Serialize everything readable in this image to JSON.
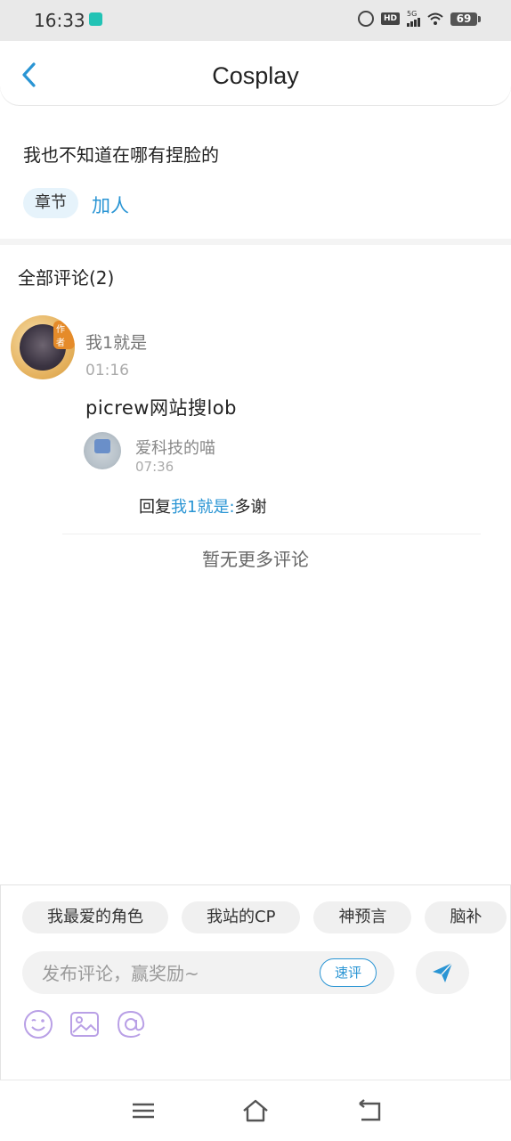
{
  "status": {
    "time": "16:33",
    "battery": "69",
    "network": "5G",
    "hd_label": "HD"
  },
  "header": {
    "title": "Cosplay",
    "back_icon": "chevron-left-icon"
  },
  "post": {
    "text": "我也不知道在哪有捏脸的",
    "tag_label": "章节",
    "tag_link": "加人"
  },
  "comments": {
    "title": "全部评论(2)",
    "items": [
      {
        "user": "我1就是",
        "time": "01:16",
        "text": "picrew网站搜lob",
        "avatar_badge": "作者",
        "reply": {
          "user": "爱科技的喵",
          "time": "07:36",
          "prefix": "回复",
          "mention": "我1就是:",
          "text": "多谢"
        }
      }
    ],
    "no_more": "暂无更多评论"
  },
  "composer": {
    "quick_chips": [
      "我最爱的角色",
      "我站的CP",
      "神预言",
      "脑补"
    ],
    "placeholder": "发布评论，赢奖励~",
    "quick_rate": "速评",
    "send_icon": "send-icon",
    "tools": [
      "emoji-icon",
      "image-icon",
      "at-icon"
    ]
  },
  "navbar": {
    "icons": [
      "menu-icon",
      "home-icon",
      "back-nav-icon"
    ]
  },
  "colors": {
    "accent": "#2a95d4",
    "tool_purple": "#b9a0e6"
  }
}
